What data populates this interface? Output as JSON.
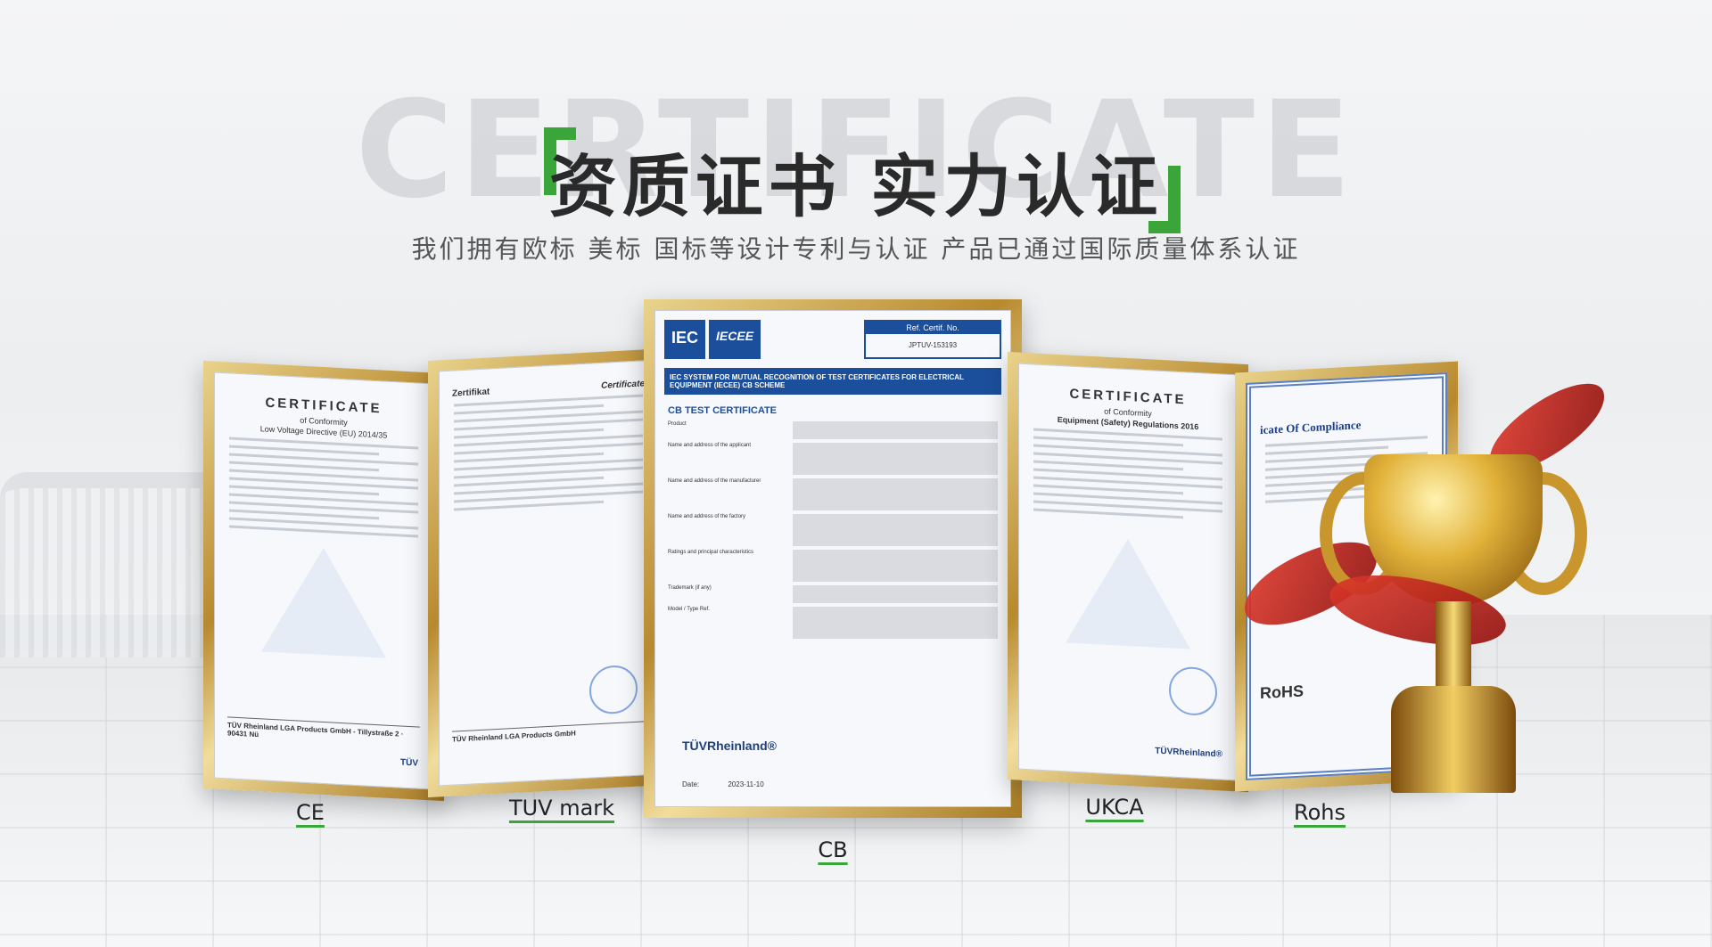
{
  "header": {
    "bg_word": "CERTIFICATE",
    "title": "资质证书 实力认证",
    "subtitle": "我们拥有欧标 美标 国标等设计专利与认证 产品已通过国际质量体系认证"
  },
  "certificates": {
    "ce": {
      "label": "CE",
      "doc_title": "CERTIFICATE",
      "doc_sub1": "of Conformity",
      "doc_sub2": "Low Voltage Directive (EU) 2014/35",
      "footer": "TÜV Rheinland LGA Products GmbH - Tillystraße 2 · 90431 Nü",
      "logo": "TÜV"
    },
    "tuv": {
      "label": "TUV mark",
      "doc_title": "Zertifikat",
      "doc_title2": "Certificate",
      "footer": "TÜV Rheinland LGA Products GmbH"
    },
    "cb": {
      "label": "CB",
      "logo1": "IEC",
      "logo2": "IECEE",
      "ref_label": "Ref. Certif. No.",
      "ref_value": "JPTUV-153193",
      "band": "IEC SYSTEM FOR MUTUAL RECOGNITION OF TEST CERTIFICATES FOR ELECTRICAL EQUIPMENT (IECEE) CB SCHEME",
      "doc_title": "CB TEST CERTIFICATE",
      "rows": [
        "Product",
        "Name and address of the applicant",
        "Name and address of the manufacturer",
        "Name and address of the factory",
        "Ratings and principal characteristics",
        "Trademark (if any)",
        "Model / Type Ref."
      ],
      "brand": "TÜVRheinland®",
      "date_label": "Date:",
      "date": "2023-11-10"
    },
    "ukca": {
      "label": "UKCA",
      "doc_title": "CERTIFICATE",
      "doc_sub1": "of Conformity",
      "doc_sub2": "Equipment (Safety) Regulations 2016",
      "logo": "TÜVRheinland®"
    },
    "rohs": {
      "label": "Rohs",
      "doc_title": "icate Of Compliance",
      "mark": "RoHS"
    }
  },
  "colors": {
    "accent_green": "#3aa63a",
    "iec_blue": "#1b4f9c",
    "frame_gold": "#c9962e",
    "ribbon_red": "#d32f2f"
  }
}
